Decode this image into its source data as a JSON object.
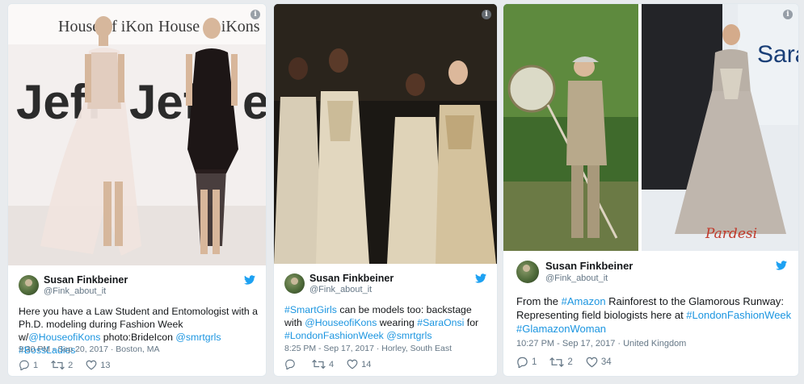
{
  "colors": {
    "link": "#1b95e0",
    "muted": "#657786",
    "bird": "#1da1f2"
  },
  "cards": [
    {
      "media_texts": [
        "House of iKon",
        "House of iKons",
        "Jeff",
        "Jef",
        "e"
      ],
      "author": {
        "name": "Susan Finkbeiner",
        "handle": "@Fink_about_it"
      },
      "text": {
        "p1": "Here you have a Law Student and Entomologist with a Ph.D. modeling during Fashion Week w/",
        "link1": "@HouseofiKons",
        "p2": " photo:BrideIcon ",
        "link2": "@smrtgrls",
        "p3": " ",
        "link3": "#BossLadies"
      },
      "meta": "9:30 PM - Sep 20, 2017 · Boston, MA",
      "replies": "1",
      "retweets": "2",
      "likes": "13"
    },
    {
      "author": {
        "name": "Susan Finkbeiner",
        "handle": "@Fink_about_it"
      },
      "text": {
        "link1": "#SmartGirls",
        "p1": " can be models too: backstage with ",
        "link2": "@HouseofiKons",
        "p2": " wearing ",
        "link3": "#SaraOnsi",
        "p3": " for ",
        "link4": "#LondonFashionWeek",
        "p4": " ",
        "link5": "@smrtgrls"
      },
      "meta": "8:25 PM - Sep 17, 2017 · Horley, South East",
      "replies": "",
      "retweets": "4",
      "likes": "14"
    },
    {
      "media_texts": [
        "Sara",
        "Pardesi"
      ],
      "author": {
        "name": "Susan Finkbeiner",
        "handle": "@Fink_about_it"
      },
      "text": {
        "p1": "From the ",
        "link1": "#Amazon",
        "p2": " Rainforest to the Glamorous Runway: Representing field biologists here at ",
        "link2": "#LondonFashionWeek",
        "p3": " ",
        "link3": "#GlamazonWoman"
      },
      "meta": "10:27 PM - Sep 17, 2017 · United Kingdom",
      "replies": "1",
      "retweets": "2",
      "likes": "34"
    }
  ]
}
